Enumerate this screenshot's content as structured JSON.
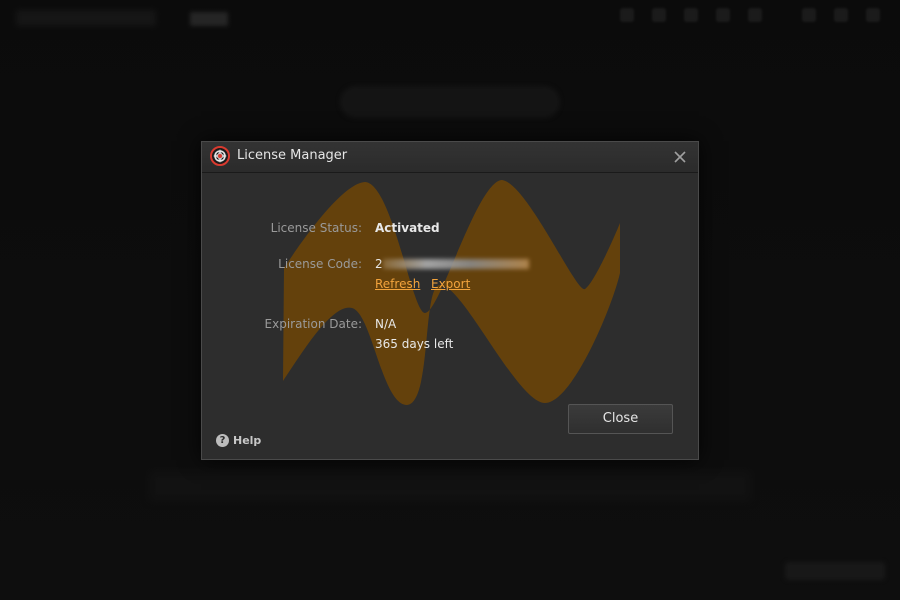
{
  "dialog": {
    "title": "License Manager",
    "icons": {
      "app": "app-logo-icon",
      "close": "close-icon",
      "help": "help-circle-icon"
    }
  },
  "license": {
    "status_label": "License Status:",
    "status_value": "Activated",
    "code_label": "License Code:",
    "code_prefix": "2",
    "refresh_link": "Refresh",
    "export_link": "Export",
    "expiration_label": "Expiration Date:",
    "expiration_value": "N/A",
    "days_left": "365 days left"
  },
  "buttons": {
    "close_label": "Close",
    "help_label": "Help"
  },
  "colors": {
    "accent": "#f2a33c",
    "watermark": "#7a4a00",
    "dialog_bg": "#2d2d2d"
  }
}
